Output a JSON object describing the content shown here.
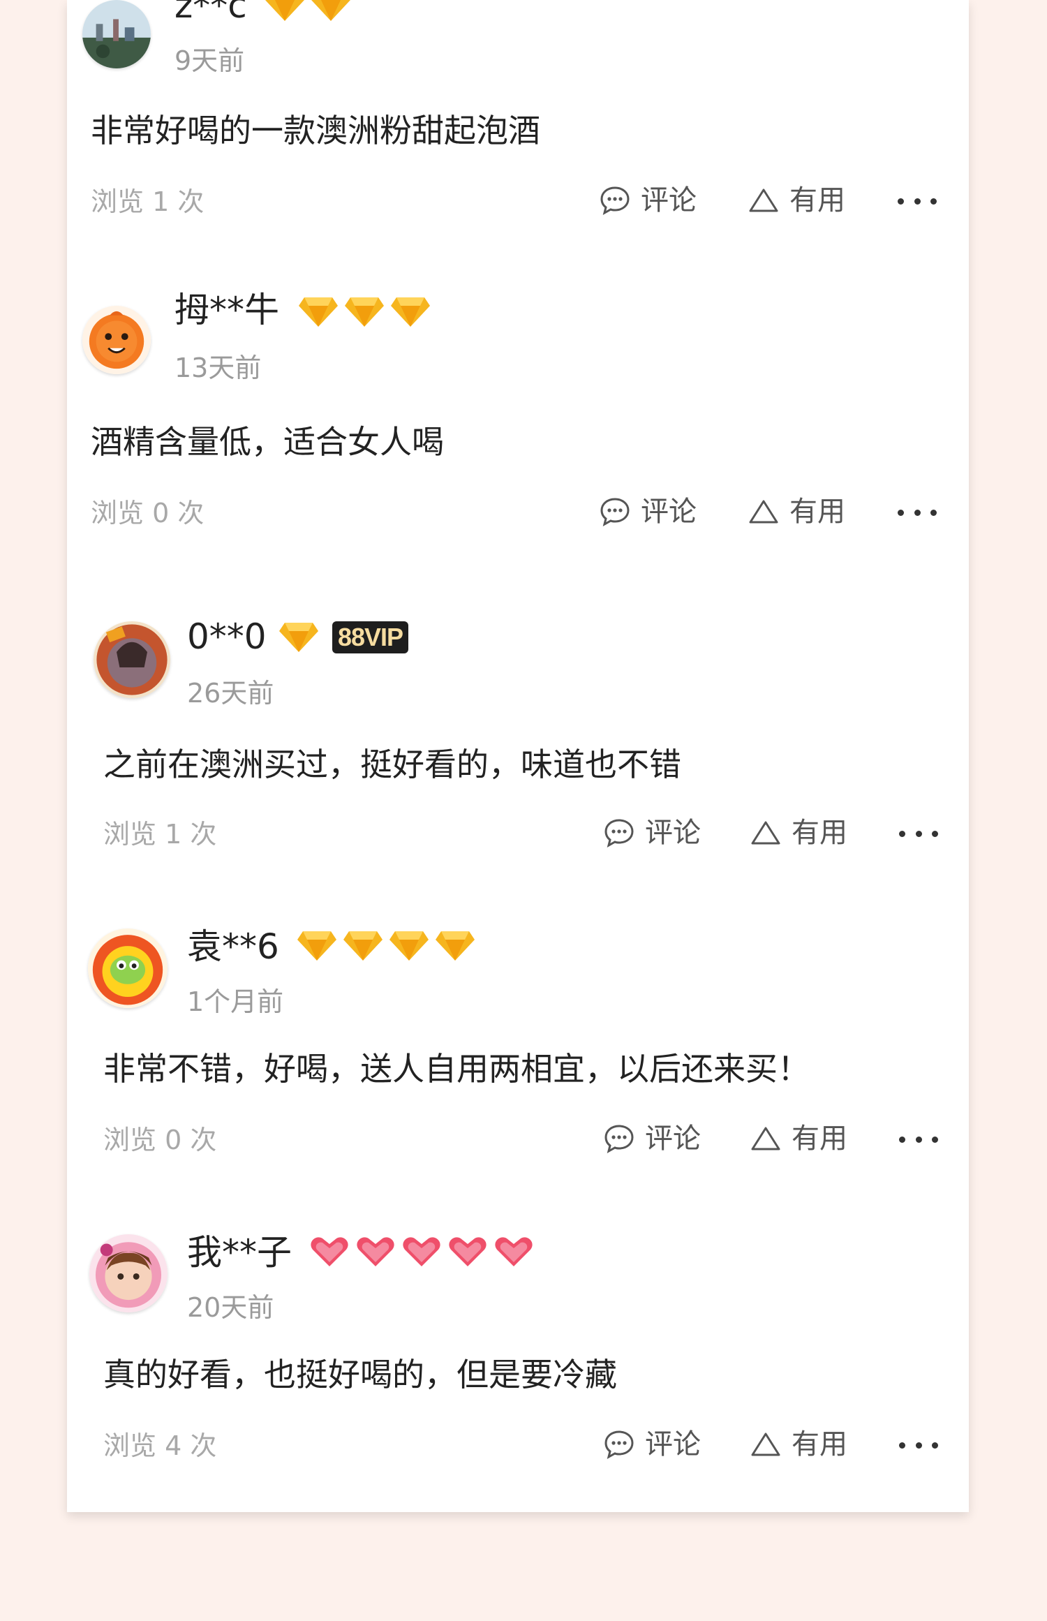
{
  "reviews": [
    {
      "name": "z**c",
      "badge_type": "diamond",
      "badge_count": 2,
      "vip": "",
      "date": "9天前",
      "content": "非常好喝的一款澳洲粉甜起泡酒",
      "views": "浏览 1 次",
      "comment_label": "评论",
      "useful_label": "有用"
    },
    {
      "name": "拇**牛",
      "badge_type": "diamond",
      "badge_count": 3,
      "vip": "",
      "date": "13天前",
      "content": "酒精含量低，适合女人喝",
      "views": "浏览 0 次",
      "comment_label": "评论",
      "useful_label": "有用"
    },
    {
      "name": "0**0",
      "badge_type": "diamond",
      "badge_count": 1,
      "vip": "88VIP",
      "date": "26天前",
      "content": "之前在澳洲买过，挺好看的，味道也不错",
      "views": "浏览 1 次",
      "comment_label": "评论",
      "useful_label": "有用"
    },
    {
      "name": "袁**6",
      "badge_type": "diamond",
      "badge_count": 4,
      "vip": "",
      "date": "1个月前",
      "content": "非常不错，好喝，送人自用两相宜，以后还来买！",
      "views": "浏览 0 次",
      "comment_label": "评论",
      "useful_label": "有用"
    },
    {
      "name": "我**子",
      "badge_type": "heart",
      "badge_count": 5,
      "vip": "",
      "date": "20天前",
      "content": "真的好看，也挺好喝的，但是要冷藏",
      "views": "浏览 4 次",
      "comment_label": "评论",
      "useful_label": "有用"
    }
  ],
  "colors": {
    "background": "#fdf1ec",
    "card": "#ffffff",
    "diamond": "#f6b51e",
    "heart": "#ef4f6a",
    "vip_bg": "#1e1e1e",
    "vip_text": "#f6dca0"
  },
  "icons": {
    "comment": "chat-bubble-icon",
    "useful": "triangle-thumb-icon",
    "more": "ellipsis-icon",
    "diamond": "diamond-badge-icon",
    "heart": "heart-badge-icon"
  }
}
